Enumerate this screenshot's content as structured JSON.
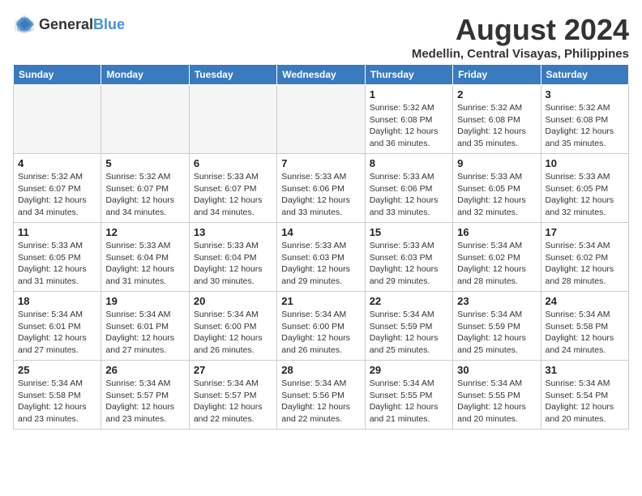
{
  "logo": {
    "general": "General",
    "blue": "Blue"
  },
  "title": "August 2024",
  "subtitle": "Medellin, Central Visayas, Philippines",
  "days_header": [
    "Sunday",
    "Monday",
    "Tuesday",
    "Wednesday",
    "Thursday",
    "Friday",
    "Saturday"
  ],
  "weeks": [
    [
      {
        "day": "",
        "info": ""
      },
      {
        "day": "",
        "info": ""
      },
      {
        "day": "",
        "info": ""
      },
      {
        "day": "",
        "info": ""
      },
      {
        "day": "1",
        "info": "Sunrise: 5:32 AM\nSunset: 6:08 PM\nDaylight: 12 hours and 36 minutes."
      },
      {
        "day": "2",
        "info": "Sunrise: 5:32 AM\nSunset: 6:08 PM\nDaylight: 12 hours and 35 minutes."
      },
      {
        "day": "3",
        "info": "Sunrise: 5:32 AM\nSunset: 6:08 PM\nDaylight: 12 hours and 35 minutes."
      }
    ],
    [
      {
        "day": "4",
        "info": "Sunrise: 5:32 AM\nSunset: 6:07 PM\nDaylight: 12 hours and 34 minutes."
      },
      {
        "day": "5",
        "info": "Sunrise: 5:32 AM\nSunset: 6:07 PM\nDaylight: 12 hours and 34 minutes."
      },
      {
        "day": "6",
        "info": "Sunrise: 5:33 AM\nSunset: 6:07 PM\nDaylight: 12 hours and 34 minutes."
      },
      {
        "day": "7",
        "info": "Sunrise: 5:33 AM\nSunset: 6:06 PM\nDaylight: 12 hours and 33 minutes."
      },
      {
        "day": "8",
        "info": "Sunrise: 5:33 AM\nSunset: 6:06 PM\nDaylight: 12 hours and 33 minutes."
      },
      {
        "day": "9",
        "info": "Sunrise: 5:33 AM\nSunset: 6:05 PM\nDaylight: 12 hours and 32 minutes."
      },
      {
        "day": "10",
        "info": "Sunrise: 5:33 AM\nSunset: 6:05 PM\nDaylight: 12 hours and 32 minutes."
      }
    ],
    [
      {
        "day": "11",
        "info": "Sunrise: 5:33 AM\nSunset: 6:05 PM\nDaylight: 12 hours and 31 minutes."
      },
      {
        "day": "12",
        "info": "Sunrise: 5:33 AM\nSunset: 6:04 PM\nDaylight: 12 hours and 31 minutes."
      },
      {
        "day": "13",
        "info": "Sunrise: 5:33 AM\nSunset: 6:04 PM\nDaylight: 12 hours and 30 minutes."
      },
      {
        "day": "14",
        "info": "Sunrise: 5:33 AM\nSunset: 6:03 PM\nDaylight: 12 hours and 29 minutes."
      },
      {
        "day": "15",
        "info": "Sunrise: 5:33 AM\nSunset: 6:03 PM\nDaylight: 12 hours and 29 minutes."
      },
      {
        "day": "16",
        "info": "Sunrise: 5:34 AM\nSunset: 6:02 PM\nDaylight: 12 hours and 28 minutes."
      },
      {
        "day": "17",
        "info": "Sunrise: 5:34 AM\nSunset: 6:02 PM\nDaylight: 12 hours and 28 minutes."
      }
    ],
    [
      {
        "day": "18",
        "info": "Sunrise: 5:34 AM\nSunset: 6:01 PM\nDaylight: 12 hours and 27 minutes."
      },
      {
        "day": "19",
        "info": "Sunrise: 5:34 AM\nSunset: 6:01 PM\nDaylight: 12 hours and 27 minutes."
      },
      {
        "day": "20",
        "info": "Sunrise: 5:34 AM\nSunset: 6:00 PM\nDaylight: 12 hours and 26 minutes."
      },
      {
        "day": "21",
        "info": "Sunrise: 5:34 AM\nSunset: 6:00 PM\nDaylight: 12 hours and 26 minutes."
      },
      {
        "day": "22",
        "info": "Sunrise: 5:34 AM\nSunset: 5:59 PM\nDaylight: 12 hours and 25 minutes."
      },
      {
        "day": "23",
        "info": "Sunrise: 5:34 AM\nSunset: 5:59 PM\nDaylight: 12 hours and 25 minutes."
      },
      {
        "day": "24",
        "info": "Sunrise: 5:34 AM\nSunset: 5:58 PM\nDaylight: 12 hours and 24 minutes."
      }
    ],
    [
      {
        "day": "25",
        "info": "Sunrise: 5:34 AM\nSunset: 5:58 PM\nDaylight: 12 hours and 23 minutes."
      },
      {
        "day": "26",
        "info": "Sunrise: 5:34 AM\nSunset: 5:57 PM\nDaylight: 12 hours and 23 minutes."
      },
      {
        "day": "27",
        "info": "Sunrise: 5:34 AM\nSunset: 5:57 PM\nDaylight: 12 hours and 22 minutes."
      },
      {
        "day": "28",
        "info": "Sunrise: 5:34 AM\nSunset: 5:56 PM\nDaylight: 12 hours and 22 minutes."
      },
      {
        "day": "29",
        "info": "Sunrise: 5:34 AM\nSunset: 5:55 PM\nDaylight: 12 hours and 21 minutes."
      },
      {
        "day": "30",
        "info": "Sunrise: 5:34 AM\nSunset: 5:55 PM\nDaylight: 12 hours and 20 minutes."
      },
      {
        "day": "31",
        "info": "Sunrise: 5:34 AM\nSunset: 5:54 PM\nDaylight: 12 hours and 20 minutes."
      }
    ]
  ]
}
